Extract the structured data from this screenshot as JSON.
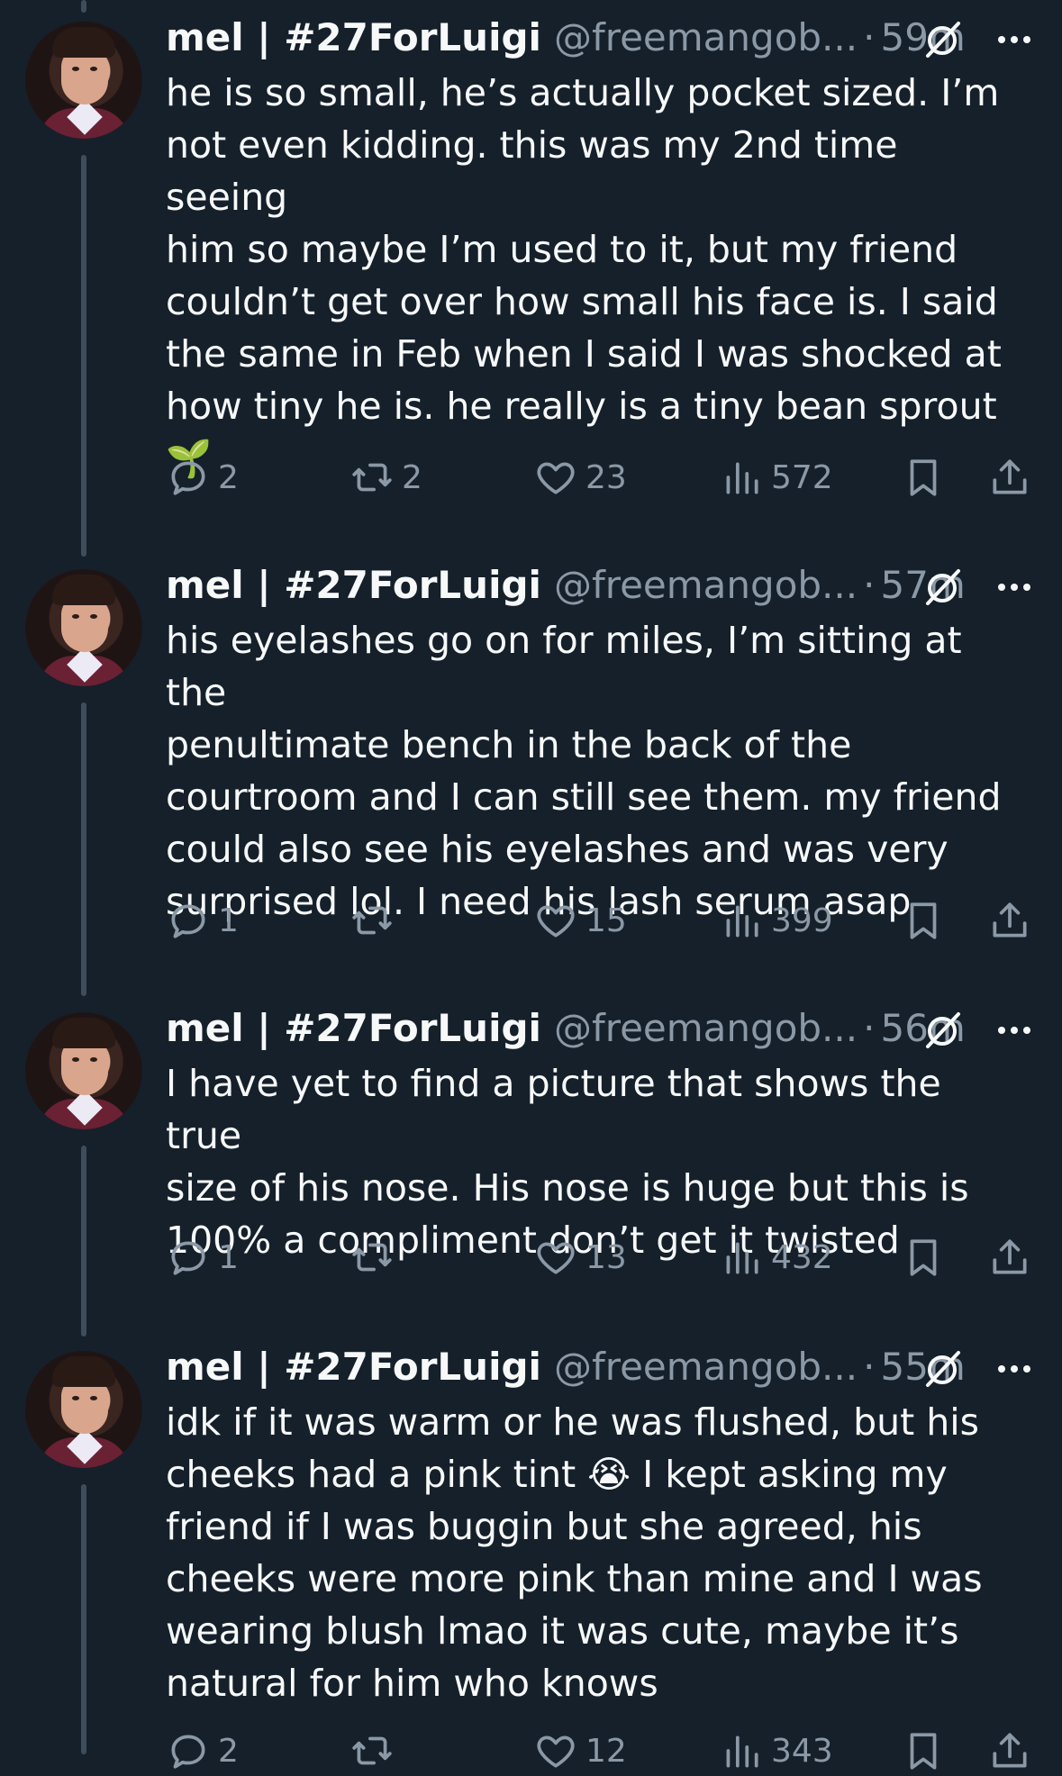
{
  "tweets": [
    {
      "name": "mel | #27ForLuigi",
      "handle": "@freemangob...",
      "dot": "·",
      "time": "59m",
      "text": "he is so small, he’s actually pocket sized. I’m\nnot even kidding. this was my 2nd time seeing\nhim so maybe I’m used to it, but my friend\ncouldn’t get over how small his face is. I said\nthe same in Feb when I said I was shocked at\nhow tiny he is. he really is a tiny bean sprout\n🌱",
      "replies": "2",
      "retweets": "2",
      "likes": "23",
      "views": "572"
    },
    {
      "name": "mel | #27ForLuigi",
      "handle": "@freemangob...",
      "dot": "·",
      "time": "57m",
      "text": "his eyelashes go on for miles, I’m sitting at the\npenultimate bench in the back of the\ncourtroom and I can still see them. my friend\ncould also see his eyelashes and was very\nsurprised lol. I need his lash serum asap",
      "replies": "1",
      "retweets": "",
      "likes": "15",
      "views": "399"
    },
    {
      "name": "mel | #27ForLuigi",
      "handle": "@freemangob...",
      "dot": "·",
      "time": "56m",
      "text": "I have yet to find a picture that shows the true\nsize of his nose. His nose is huge but this is\n100% a compliment don’t get it twisted",
      "replies": "1",
      "retweets": "",
      "likes": "13",
      "views": "432"
    },
    {
      "name": "mel | #27ForLuigi",
      "handle": "@freemangob...",
      "dot": "·",
      "time": "55m",
      "text": "idk if it was warm or he was flushed, but his\ncheeks had a pink tint 😭 I kept asking my\nfriend if I was buggin but she agreed, his\ncheeks were more pink than mine and I was\nwearing blush lmao it was cute, maybe it’s\nnatural for him who knows",
      "replies": "2",
      "retweets": "",
      "likes": "12",
      "views": "343"
    }
  ],
  "icons": {
    "reply": "reply-icon",
    "retweet": "retweet-icon",
    "like": "heart-icon",
    "views": "views-icon",
    "bookmark": "bookmark-icon",
    "share": "share-icon",
    "mute": "mute-icon",
    "more": "more-icon"
  },
  "colors": {
    "background": "#15202b",
    "text": "#f7f9f9",
    "muted": "#8b98a5",
    "thread_line": "#3e4d5c"
  }
}
